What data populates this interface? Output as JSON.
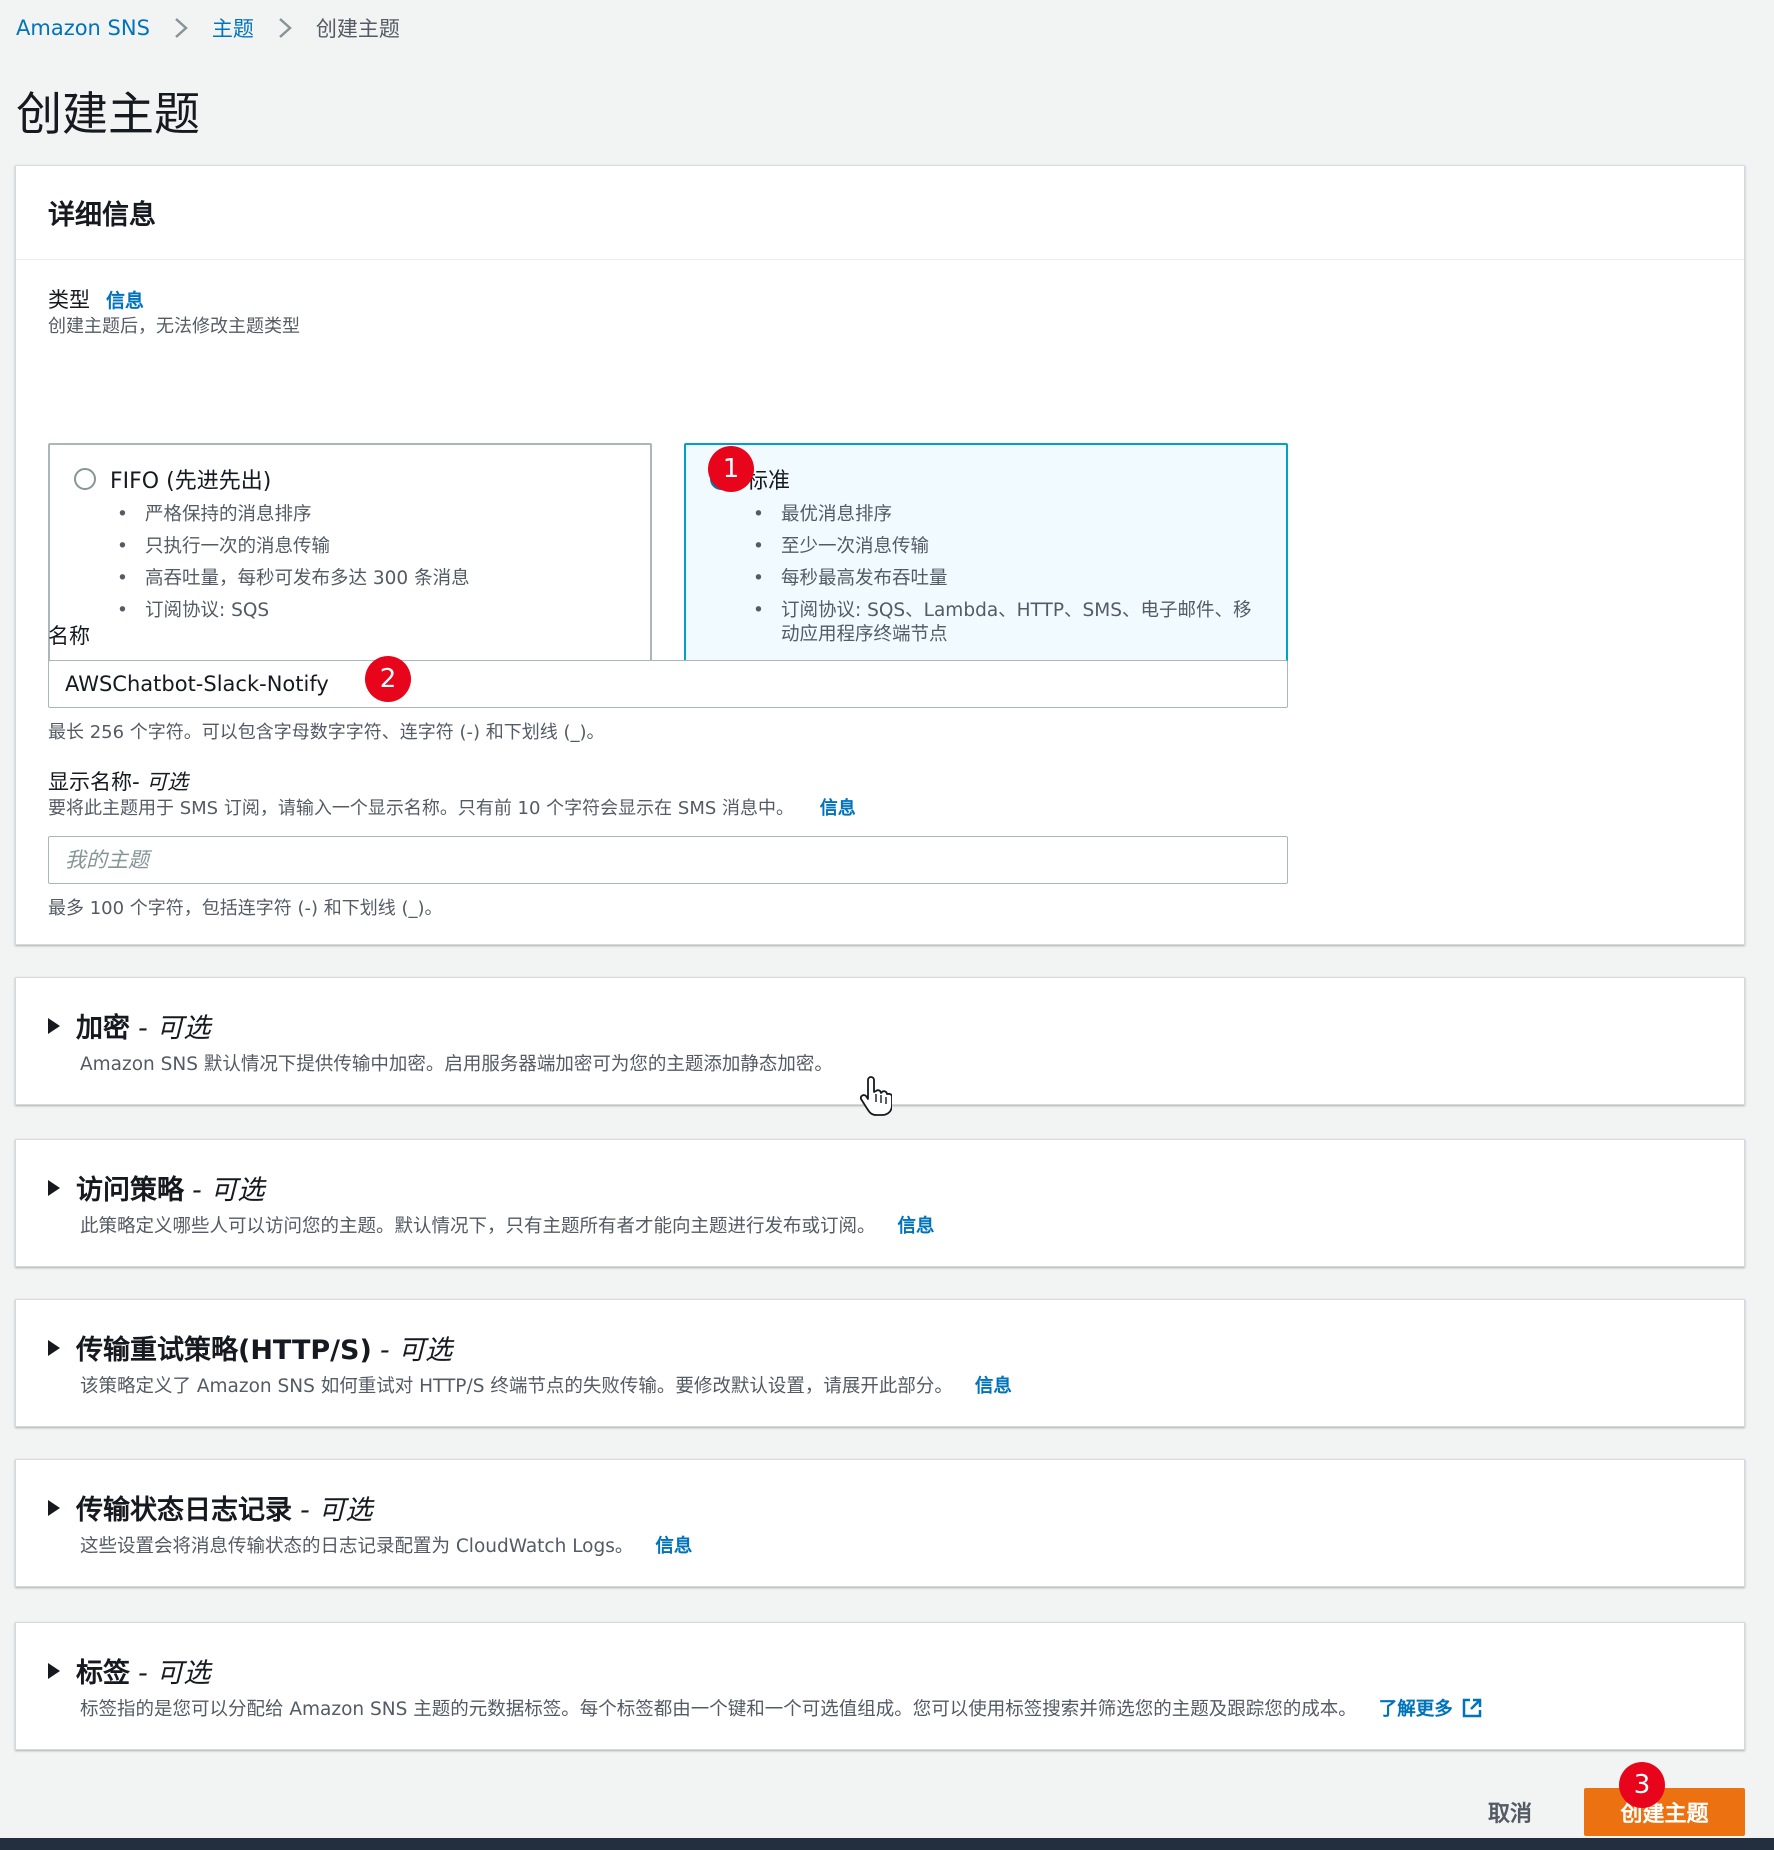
{
  "breadcrumb": {
    "root": "Amazon SNS",
    "topics": "主题",
    "current": "创建主题"
  },
  "page": {
    "title": "创建主题"
  },
  "details": {
    "heading": "详细信息",
    "type_label": "类型",
    "type_info": "信息",
    "type_desc": "创建主题后，无法修改主题类型",
    "fifo": {
      "title": "FIFO (先进先出)",
      "bullets": [
        "严格保持的消息排序",
        "只执行一次的消息传输",
        "高吞吐量，每秒可发布多达 300 条消息",
        "订阅协议: SQS"
      ]
    },
    "standard": {
      "title": "标准",
      "bullets": [
        "最优消息排序",
        "至少一次消息传输",
        "每秒最高发布吞吐量",
        "订阅协议: SQS、Lambda、HTTP、SMS、电子邮件、移动应用程序终端节点"
      ]
    },
    "selected_type": "standard",
    "name_label": "名称",
    "name_value": "AWSChatbot-Slack-Notify",
    "name_constraint": "最长 256 个字符。可以包含字母数字字符、连字符 (-) 和下划线 (_)。",
    "display_label": "显示名称",
    "display_optional": " - 可选",
    "display_desc": "要将此主题用于 SMS 订阅，请输入一个显示名称。只有前 10 个字符会显示在 SMS 消息中。",
    "display_info": "信息",
    "display_placeholder": "我的主题",
    "display_constraint": "最多 100 个字符，包括连字符 (-) 和下划线 (_)。"
  },
  "sections": [
    {
      "title": "加密",
      "optional": "- 可选",
      "desc": "Amazon SNS 默认情况下提供传输中加密。启用服务器端加密可为您的主题添加静态加密。",
      "link": ""
    },
    {
      "title": "访问策略",
      "optional": "- 可选",
      "desc": "此策略定义哪些人可以访问您的主题。默认情况下，只有主题所有者才能向主题进行发布或订阅。",
      "link": "信息"
    },
    {
      "title": "传输重试策略(HTTP/S)",
      "optional": "- 可选",
      "desc": "该策略定义了 Amazon SNS 如何重试对 HTTP/S 终端节点的失败传输。要修改默认设置，请展开此部分。",
      "link": "信息"
    },
    {
      "title": "传输状态日志记录",
      "optional": "- 可选",
      "desc": "这些设置会将消息传输状态的日志记录配置为 CloudWatch Logs。",
      "link": "信息"
    },
    {
      "title": "标签",
      "optional": "- 可选",
      "desc": "标签指的是您可以分配给 Amazon SNS 主题的元数据标签。每个标签都由一个键和一个可选值组成。您可以使用标签搜索并筛选您的主题及跟踪您的成本。",
      "link": "了解更多"
    }
  ],
  "footer": {
    "cancel": "取消",
    "create": "创建主题"
  },
  "annotations": [
    "1",
    "2",
    "3"
  ],
  "icons": {
    "breadcrumb_sep": "chevron-right-icon",
    "expand": "caret-right-icon",
    "external": "external-link-icon",
    "cursor": "hand-pointer-icon"
  },
  "colors": {
    "primary": "#ec7211",
    "link": "#0073bb",
    "selected_tile": "#f1faff",
    "badge": "#e8041a"
  }
}
